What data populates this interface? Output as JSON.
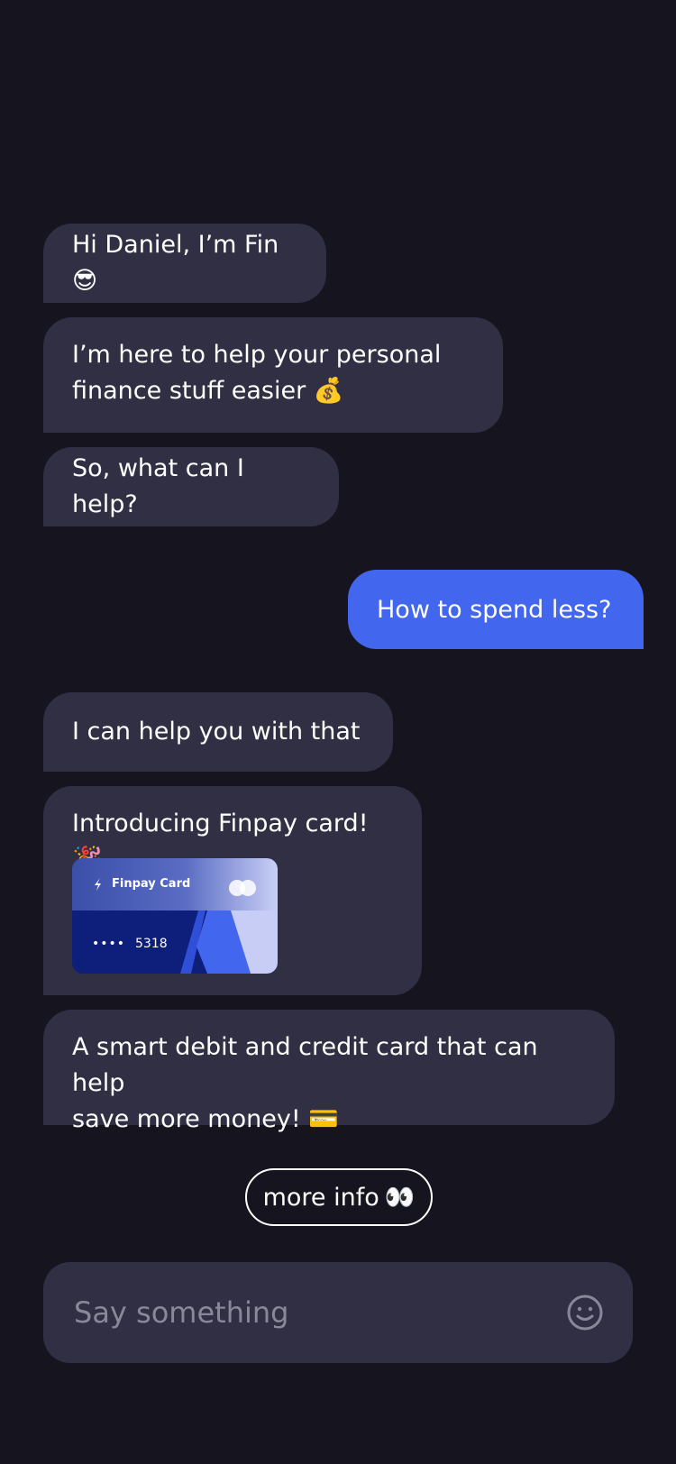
{
  "messages": {
    "m1": "Hi Daniel, I’m Fin 😎",
    "m2_line1": "I’m here to help your personal",
    "m2_line2": "finance stuff easier 💰",
    "m3": "So, what can I help?",
    "user": "How to spend less?",
    "m4": "I can help you with that",
    "m5": "Introducing Finpay card! 🎉",
    "m6_line1": "A smart debit and credit card that can help",
    "m6_line2": "save more money! 💳"
  },
  "card": {
    "brand": "Finpay Card",
    "masked": "••••",
    "last4": "5318"
  },
  "more_info": {
    "label": "more info",
    "emoji": "👀"
  },
  "composer": {
    "placeholder": "Say something"
  },
  "colors": {
    "background": "#16151f",
    "bot_bubble": "#302f44",
    "user_bubble": "#4366ef"
  }
}
